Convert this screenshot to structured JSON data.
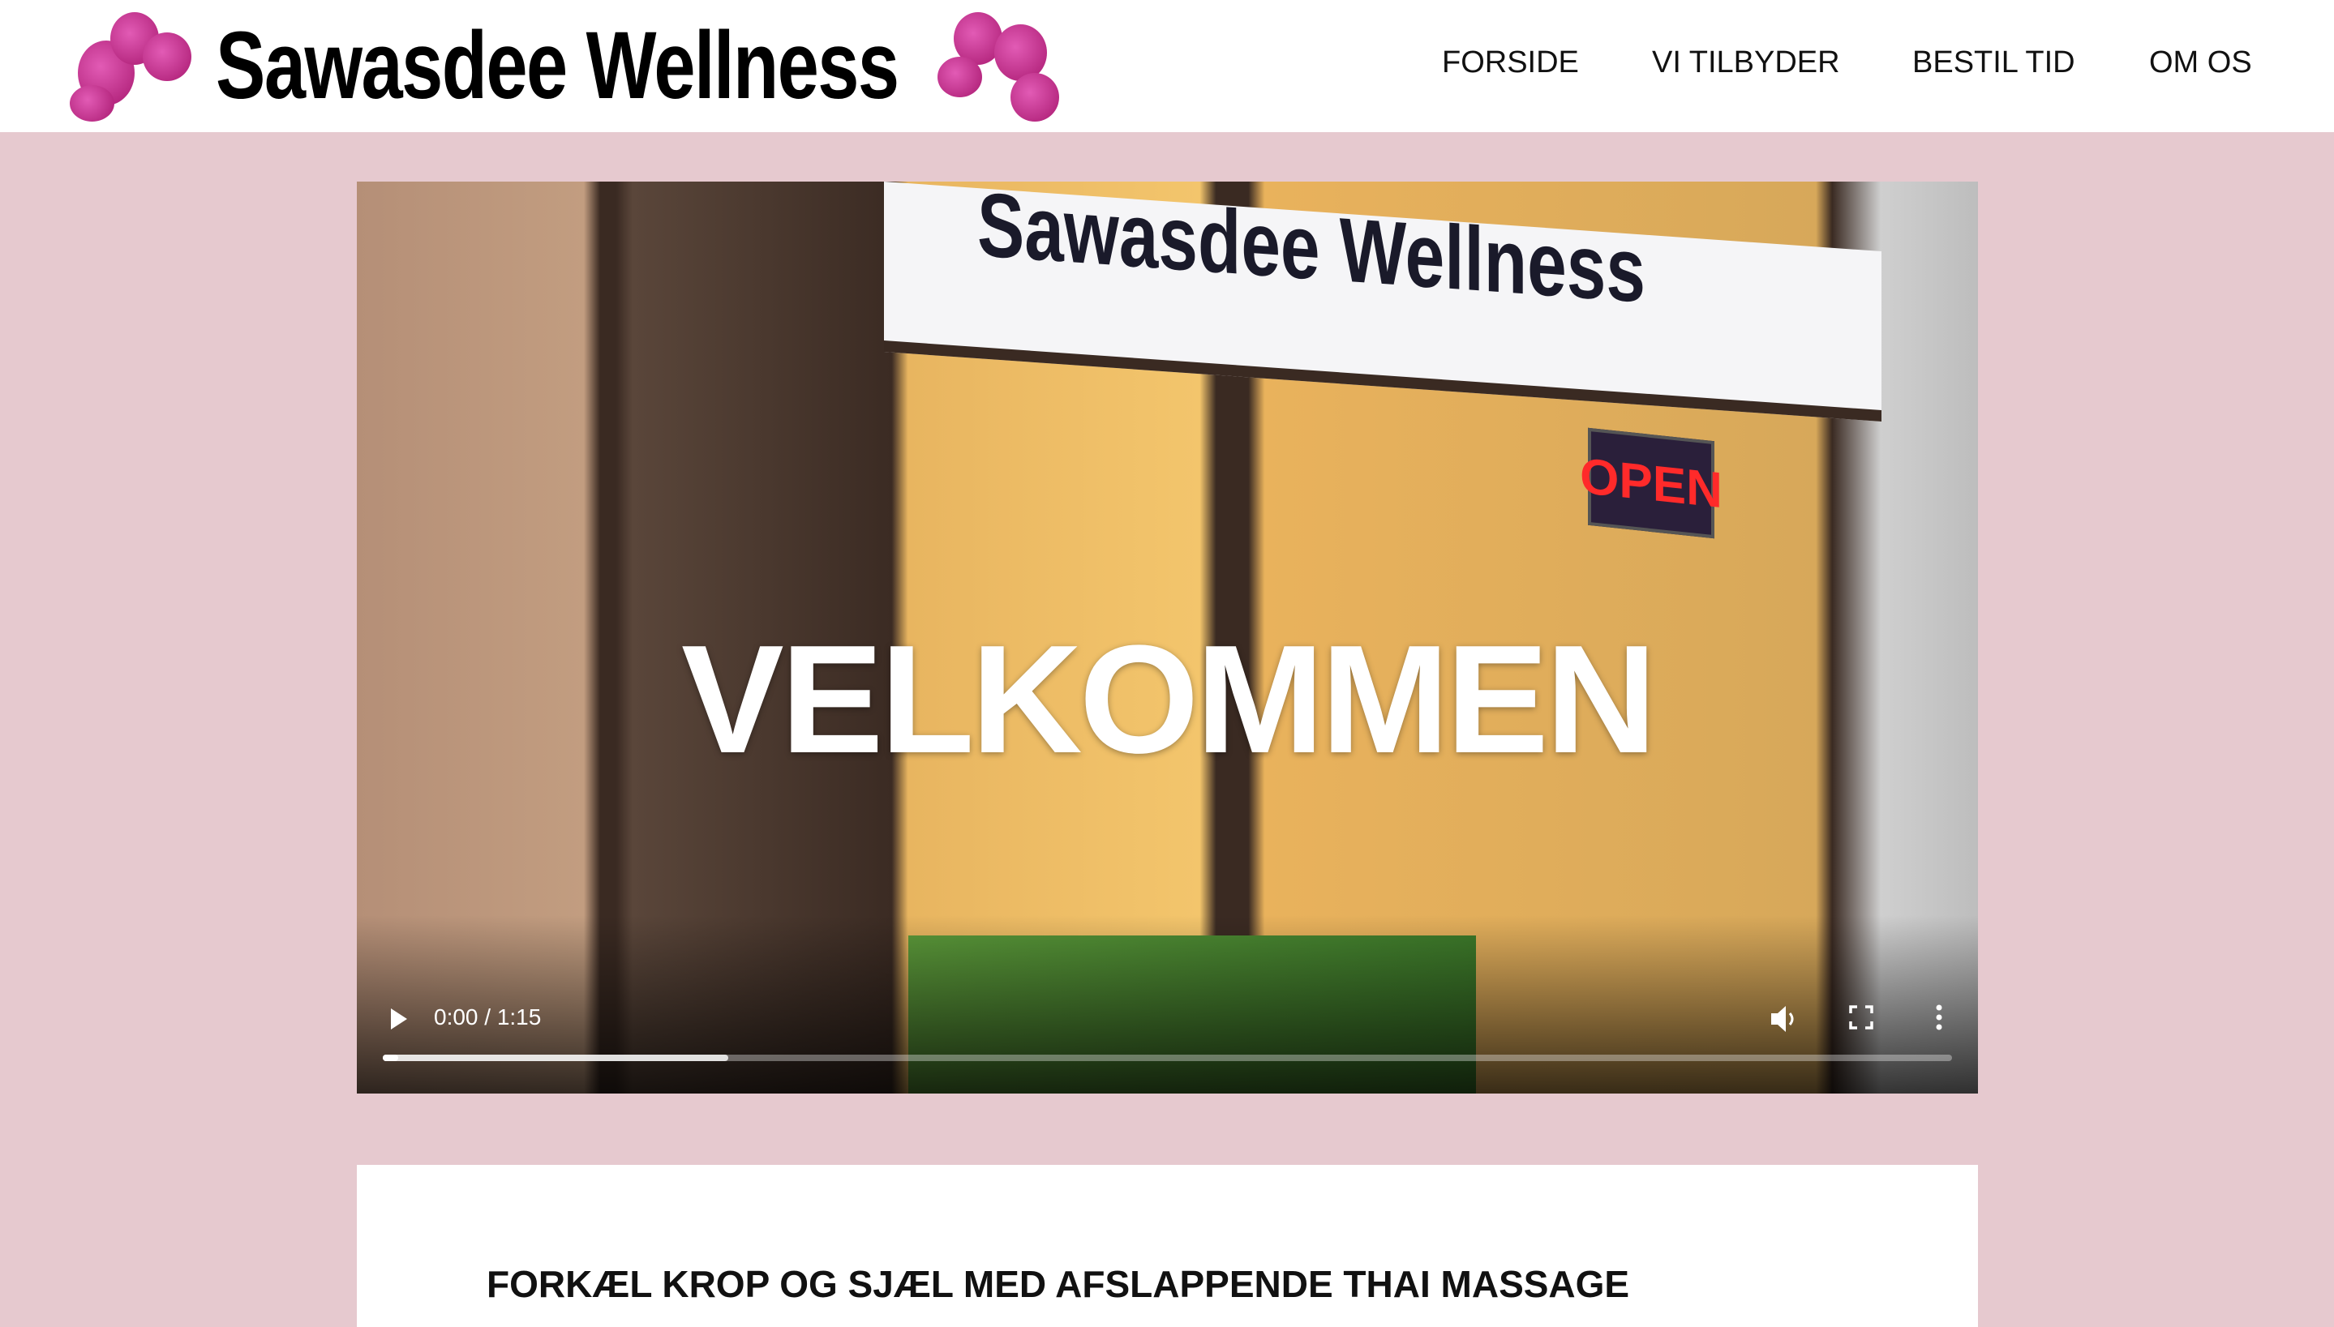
{
  "site": {
    "logo_text": "Sawasdee Wellness"
  },
  "nav": [
    {
      "label": "FORSIDE"
    },
    {
      "label": "VI TILBYDER"
    },
    {
      "label": "BESTIL TID"
    },
    {
      "label": "OM OS"
    }
  ],
  "video": {
    "overlay_title": "VELKOMMEN",
    "sign_text": "Sawasdee Wellness",
    "open_sign": "OPEN",
    "time": "0:00 / 1:15",
    "buffered_percent": 22,
    "played_percent": 1
  },
  "content": {
    "heading": "FORKÆL KROP OG SJÆL MED AFSLAPPENDE THAI MASSAGE"
  },
  "colors": {
    "page_bg": "#e6c9cf",
    "orchid": "#c0288a"
  }
}
